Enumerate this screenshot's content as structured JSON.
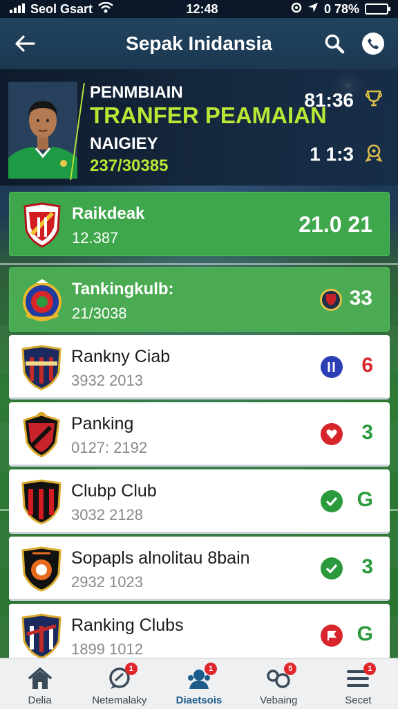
{
  "status_bar": {
    "carrier": "Seol Gsart",
    "time": "12:48",
    "battery": "0 78%"
  },
  "header": {
    "title": "Sepak Inidansia"
  },
  "hero": {
    "line1": "PENMBIAIN",
    "line2": "TRANFER PEAMAIAN",
    "line3": "NAIGIEY",
    "line4": "237/30385",
    "stat1": "81:36",
    "stat2": "1 1:3"
  },
  "rows": [
    {
      "name": "Raikdeak",
      "sub": "12.387",
      "score": "21.0 21",
      "style": "green"
    },
    {
      "name": "Tankingkulb:",
      "sub": "21/3038",
      "value": "33",
      "style": "green"
    },
    {
      "name": "Rankny Ciab",
      "sub": "3932 2013",
      "value": "6",
      "style": "white",
      "badge_color": "#2b3fb5",
      "value_color": "#d7262b"
    },
    {
      "name": "Panking",
      "sub": "0127: 2192",
      "value": "3",
      "style": "white",
      "badge_color": "#d7262b",
      "value_color": "#2b9a3c"
    },
    {
      "name": "Clubp Club",
      "sub": "3032 2128",
      "value": "G",
      "style": "white",
      "badge_color": "#2b9a3c",
      "value_color": "#2b9a3c"
    },
    {
      "name": "Sopapls alnolitau 8bain",
      "sub": "2932 1023",
      "value": "3",
      "style": "white",
      "badge_color": "#2b9a3c",
      "value_color": "#2b9a3c"
    },
    {
      "name": "Ranking Clubs",
      "sub": "1899 1012",
      "value": "G",
      "style": "white",
      "badge_color": "#d7262b",
      "value_color": "#2b9a3c"
    }
  ],
  "bottom_nav": [
    {
      "label": "Delia",
      "icon": "home-icon"
    },
    {
      "label": "Netemalaky",
      "icon": "chat-icon",
      "badge": "1"
    },
    {
      "label": "Diaetsois",
      "icon": "team-icon",
      "badge": "1",
      "active": true
    },
    {
      "label": "Vebaing",
      "icon": "transfer-icon",
      "badge": "5"
    },
    {
      "label": "Secet",
      "icon": "menu-icon",
      "badge": "1"
    }
  ],
  "colors": {
    "header": "#22435f",
    "accent_lime": "#b8e835",
    "row_green": "#3ea64b",
    "badge_red": "#d7262b",
    "badge_green": "#2b9a3c",
    "badge_blue": "#2b3fb5"
  }
}
